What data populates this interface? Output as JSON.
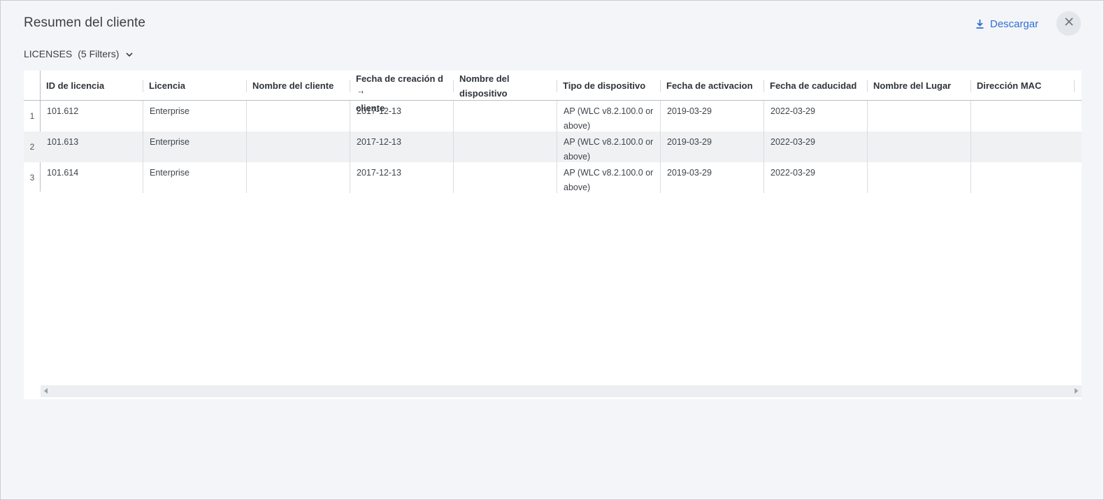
{
  "dialog": {
    "title": "Resumen del cliente",
    "download_label": "Descargar",
    "close_icon": "close-icon",
    "download_icon": "download-icon"
  },
  "filters": {
    "label": "LICENSES",
    "count": "(5 Filters)",
    "icon": "chevron-down-icon"
  },
  "table": {
    "columns": [
      "ID de licencia",
      "Licencia",
      "Nombre del cliente",
      "Fecha de creación d",
      "Nombre del dispositivo",
      "Tipo de dispositivo",
      "Fecha de activacion",
      "Fecha de caducidad",
      "Nombre del Lugar",
      "Dirección MAC"
    ],
    "rows": [
      {
        "num": "1",
        "cells": [
          "101.612",
          "Enterprise",
          "",
          "2017-12-13",
          "",
          "AP (WLC v8.2.100.0 or above)",
          "2019-03-29",
          "2022-03-29",
          "",
          ""
        ]
      },
      {
        "num": "2",
        "cells": [
          "101.613",
          "Enterprise",
          "",
          "2017-12-13",
          "",
          "AP (WLC v8.2.100.0 or above)",
          "2019-03-29",
          "2022-03-29",
          "",
          ""
        ]
      },
      {
        "num": "3",
        "cells": [
          "101.614",
          "Enterprise",
          "",
          "2017-12-13",
          "",
          "AP (WLC v8.2.100.0 or above)",
          "2019-03-29",
          "2022-03-29",
          "",
          ""
        ]
      }
    ]
  },
  "colors": {
    "accent": "#2f6fd1",
    "background": "#f4f5f8",
    "row_alt": "#eff1f3"
  }
}
